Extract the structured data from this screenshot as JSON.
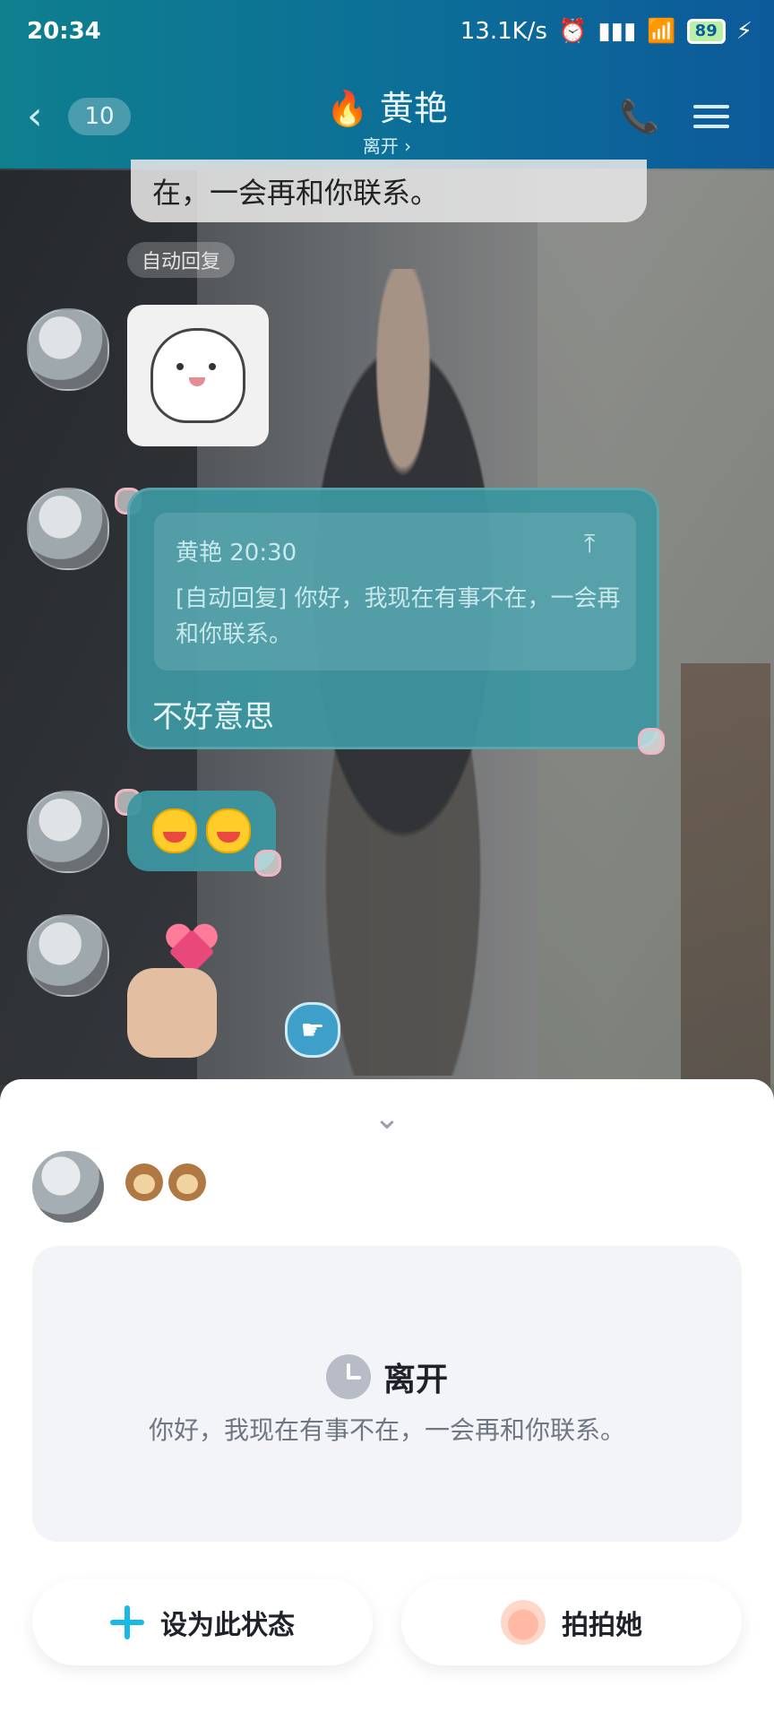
{
  "status_bar": {
    "time": "20:34",
    "network_speed": "13.1K/s",
    "battery": "89"
  },
  "header": {
    "back_count": "10",
    "contact_name": "黄艳",
    "presence": "离开 ›"
  },
  "chat": {
    "top_bubble_text": "在，一会再和你联系。",
    "auto_reply_tag": "自动回复",
    "quote": {
      "sender_time": "黄艳 20:30",
      "text": "[自动回复] 你好，我现在有事不在，一会再和你联系。"
    },
    "reply_text": "不好意思"
  },
  "sheet": {
    "status_title": "离开",
    "status_message": "你好，我现在有事不在，一会再和你联系。",
    "set_status_label": "设为此状态",
    "poke_label": "拍拍她"
  },
  "icons": {
    "back": "chevron-left-icon",
    "call": "phone-icon",
    "menu": "menu-icon",
    "clock": "clock-icon",
    "plus": "plus-icon",
    "clap": "clap-icon"
  },
  "colors": {
    "header": "#0c6e98",
    "bubble": "#3c96a0",
    "accent": "#18b8e8"
  }
}
